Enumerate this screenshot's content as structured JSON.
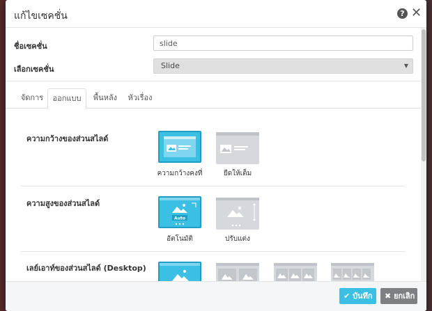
{
  "modal": {
    "title": "แก้ไขเซคชั่น"
  },
  "form": {
    "name_label": "ชื่อเซคชั่น",
    "name_value": "slide",
    "select_label": "เลือกเซคชั่น",
    "select_value": "Slide"
  },
  "tabs": [
    {
      "label": "จัดการ"
    },
    {
      "label": "ออกแบบ",
      "active": true
    },
    {
      "label": "พื้นหลัง"
    },
    {
      "label": "หัวเรื่อง"
    }
  ],
  "sections": {
    "width": {
      "title": "ความกว้างของส่วนสไลด์",
      "options": [
        {
          "caption": "ความกว้างคงที่",
          "selected": true
        },
        {
          "caption": "ยืดให้เต็ม",
          "selected": false
        }
      ]
    },
    "height": {
      "title": "ความสูงของส่วนสไลด์",
      "auto_label": "Auto",
      "options": [
        {
          "caption": "อัตโนมัติ",
          "selected": true
        },
        {
          "caption": "ปรับแต่ง",
          "selected": false
        }
      ]
    },
    "layout": {
      "title": "เลย์เอาท์ของส่วนสไลด์ (Desktop)"
    }
  },
  "footer": {
    "save_label": "บันทึก",
    "cancel_label": "ยกเลิก"
  },
  "colors": {
    "accent": "#3bbfe2",
    "accent_border": "#1e9dc5",
    "option_gray": "#d6d8db",
    "cancel_gray": "#7d7f82"
  },
  "icons": {
    "help": "question-circle-icon",
    "close": "close-icon",
    "save": "check-icon",
    "cancel": "x-icon",
    "option_image": "image-icon"
  }
}
